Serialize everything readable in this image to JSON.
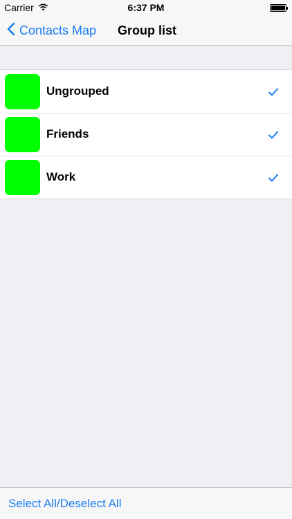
{
  "status_bar": {
    "carrier": "Carrier",
    "time": "6:37 PM",
    "icons": [
      "wifi-icon",
      "battery-icon"
    ]
  },
  "nav": {
    "back_label": "Contacts Map",
    "title": "Group list",
    "accent_color": "#1a7cf1"
  },
  "groups": [
    {
      "label": "Ungrouped",
      "color": "#00ff00",
      "checked": true
    },
    {
      "label": "Friends",
      "color": "#00ff00",
      "checked": true
    },
    {
      "label": "Work",
      "color": "#00ff00",
      "checked": true
    }
  ],
  "toolbar": {
    "select_all_label": "Select All/Deselect All"
  }
}
